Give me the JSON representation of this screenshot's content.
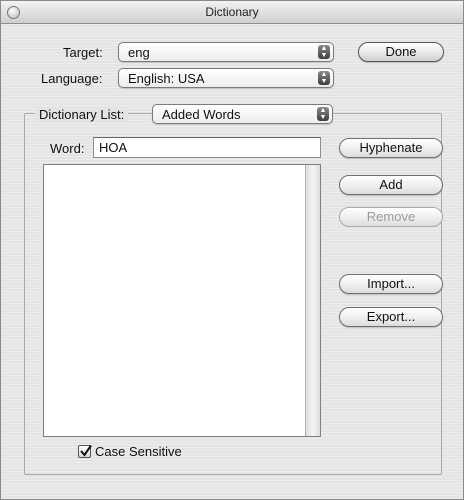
{
  "window": {
    "title": "Dictionary"
  },
  "target": {
    "label": "Target:",
    "value": "eng"
  },
  "language": {
    "label": "Language:",
    "value": "English: USA"
  },
  "buttons": {
    "done": "Done",
    "hyphenate": "Hyphenate",
    "add": "Add",
    "remove": "Remove",
    "import": "Import...",
    "export": "Export..."
  },
  "dictionary_list": {
    "label": "Dictionary List:",
    "value": "Added Words"
  },
  "word": {
    "label": "Word:",
    "value": "HOA"
  },
  "word_list": {
    "items": []
  },
  "case_sensitive": {
    "label": "Case Sensitive",
    "checked": true
  },
  "icons": {
    "close": "close-icon",
    "popup_arrows": "popup-arrows-icon",
    "checkmark": "checkmark-icon"
  },
  "colors": {
    "window_bg": "#e4e4e4",
    "list_bg": "#ffffff",
    "disabled_text": "#9a9a9a"
  }
}
